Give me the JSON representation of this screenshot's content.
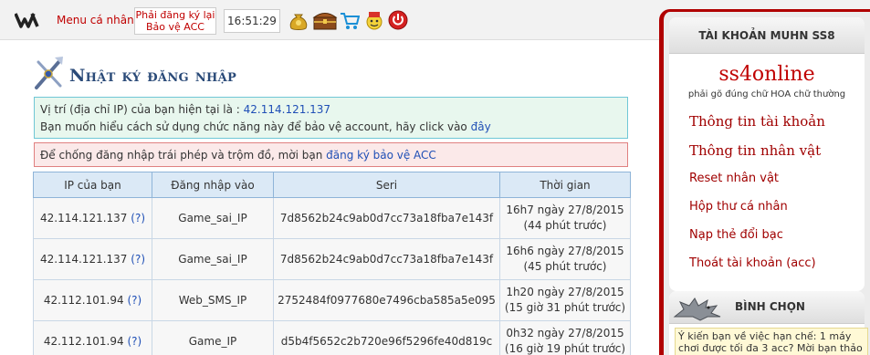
{
  "topbar": {
    "menu_label": "Menu cá nhân",
    "warning_line1": "Phải đăng ký lại",
    "warning_line2": "Bảo vệ ACC",
    "clock": "16:51:29",
    "icons": [
      "logo-w-icon",
      "money-bag-icon",
      "treasure-chest-icon",
      "shopping-cart-icon",
      "gift-icon",
      "power-icon"
    ]
  },
  "main": {
    "title": "Nhật ký đăng nhập",
    "info": {
      "ip_prefix": "Vị trí (địa chỉ IP) của bạn hiện tại là : ",
      "ip_value": "42.114.121.137",
      "help_prefix": "Bạn muốn hiểu cách sử dụng chức năng này để bảo vệ account, hãy click vào ",
      "help_link": "đây"
    },
    "alert": {
      "prefix": "Để chống đăng nhập trái phép và trộm đồ, mời bạn ",
      "link": "đăng ký bảo vệ ACC"
    },
    "table": {
      "headers": [
        "IP của bạn",
        "Đăng nhập vào",
        "Seri",
        "Thời gian"
      ],
      "rows": [
        {
          "ip": "42.114.121.137",
          "q": "(?)",
          "target": "Game_sai_IP",
          "seri": "7d8562b24c9ab0d7cc73a18fba7e143f",
          "time": "16h7 ngày 27/8/2015",
          "ago": "(44 phút trước)"
        },
        {
          "ip": "42.114.121.137",
          "q": "(?)",
          "target": "Game_sai_IP",
          "seri": "7d8562b24c9ab0d7cc73a18fba7e143f",
          "time": "16h6 ngày 27/8/2015",
          "ago": "(45 phút trước)"
        },
        {
          "ip": "42.112.101.94",
          "q": "(?)",
          "target": "Web_SMS_IP",
          "seri": "2752484f0977680e7496cba585a5e095",
          "time": "1h20 ngày 27/8/2015",
          "ago": "(15 giờ 31 phút trước)"
        },
        {
          "ip": "42.112.101.94",
          "q": "(?)",
          "target": "Game_IP",
          "seri": "d5b4f5652c2b720e96f5296fe40d819c",
          "time": "0h32 ngày 27/8/2015",
          "ago": "(16 giờ 19 phút trước)"
        }
      ]
    }
  },
  "sidebar": {
    "header": "TÀI KHOẢN MUHN SS8",
    "brand": "ss4online",
    "brand_note": "phải gõ đúng chữ HOA chữ thường",
    "links": [
      "Thông tin tài khoản",
      "Thông tin nhân vật",
      "Reset nhân vật",
      "Hộp thư cá nhân",
      "Nạp thẻ đổi bạc",
      "Thoát tài khoản (acc)"
    ],
    "vote": {
      "title": "BÌNH CHỌN",
      "text": "Ý kiến bạn về việc hạn chế: 1 máy chơi được tối đa 3 acc? Mời bạn thảo"
    }
  },
  "colors": {
    "accent_red": "#c00000",
    "link_blue": "#1f4fb6",
    "title_blue": "#2a4a78",
    "header_blue": "#dbe9f6"
  }
}
